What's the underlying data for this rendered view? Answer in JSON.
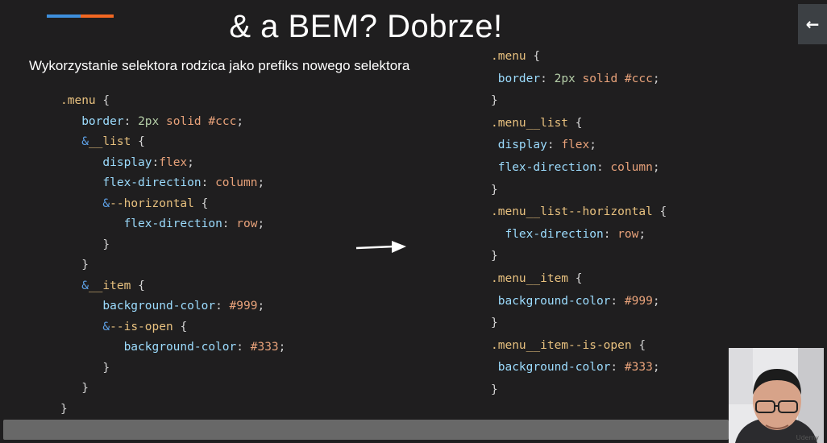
{
  "slide": {
    "title": "& a BEM? Dobrze!",
    "subtitle": "Wykorzystanie selektora rodzica jako prefiks nowego selektora"
  },
  "accent_colors": {
    "blue": "#3e8fdc",
    "orange": "#f26722"
  },
  "code_left": {
    "l1_sel": ".menu",
    "l1_brace": "{",
    "l2_prop": "border",
    "l2_colon": ":",
    "l2_num": "2px",
    "l2_val": "solid #ccc",
    "l2_semi": ";",
    "l3_amp": "&",
    "l3_sel": "__list",
    "l3_brace": "{",
    "l4_prop": "display",
    "l4_colon": ":",
    "l4_val": "flex",
    "l4_semi": ";",
    "l5_prop": "flex-direction",
    "l5_colon": ":",
    "l5_val": "column",
    "l5_semi": ";",
    "l6_amp": "&",
    "l6_sel": "--horizontal",
    "l6_brace": "{",
    "l7_prop": "flex-direction",
    "l7_colon": ":",
    "l7_val": "row",
    "l7_semi": ";",
    "l8_close": "}",
    "l9_close": "}",
    "l10_amp": "&",
    "l10_sel": "__item",
    "l10_brace": "{",
    "l11_prop": "background-color",
    "l11_colon": ":",
    "l11_val": "#999",
    "l11_semi": ";",
    "l12_amp": "&",
    "l12_sel": "--is-open",
    "l12_brace": "{",
    "l13_prop": "background-color",
    "l13_colon": ":",
    "l13_val": "#333",
    "l13_semi": ";",
    "l14_close": "}",
    "l15_close": "}",
    "l16_close": "}"
  },
  "code_right": {
    "r1_sel": ".menu",
    "r1_brace": "{",
    "r2_prop": "border",
    "r2_colon": ":",
    "r2_num": "2px",
    "r2_val": "solid #ccc",
    "r2_semi": ";",
    "r3_close": "}",
    "r4_sel": ".menu__list",
    "r4_brace": "{",
    "r5_prop": "display",
    "r5_colon": ":",
    "r5_val": "flex",
    "r5_semi": ";",
    "r6_prop": "flex-direction",
    "r6_colon": ":",
    "r6_val": "column",
    "r6_semi": ";",
    "r7_close": "}",
    "r8_sel": ".menu__list--horizontal",
    "r8_brace": "{",
    "r9_prop": "flex-direction",
    "r9_colon": ":",
    "r9_val": "row",
    "r9_semi": ";",
    "r10_close": "}",
    "r11_sel": ".menu__item",
    "r11_brace": "{",
    "r12_prop": "background-color",
    "r12_colon": ":",
    "r12_val": "#999",
    "r12_semi": ";",
    "r13_close": "}",
    "r14_sel": ".menu__item--is-open",
    "r14_brace": "{",
    "r15_prop": "background-color",
    "r15_colon": ":",
    "r15_val": "#333",
    "r15_semi": ";",
    "r16_close": "}"
  },
  "icons": {
    "arrow": "arrow-right-icon",
    "back": "arrow-left-icon"
  },
  "back_button": {
    "glyph": "←"
  },
  "webcam": {
    "watermark": "Udemy"
  }
}
